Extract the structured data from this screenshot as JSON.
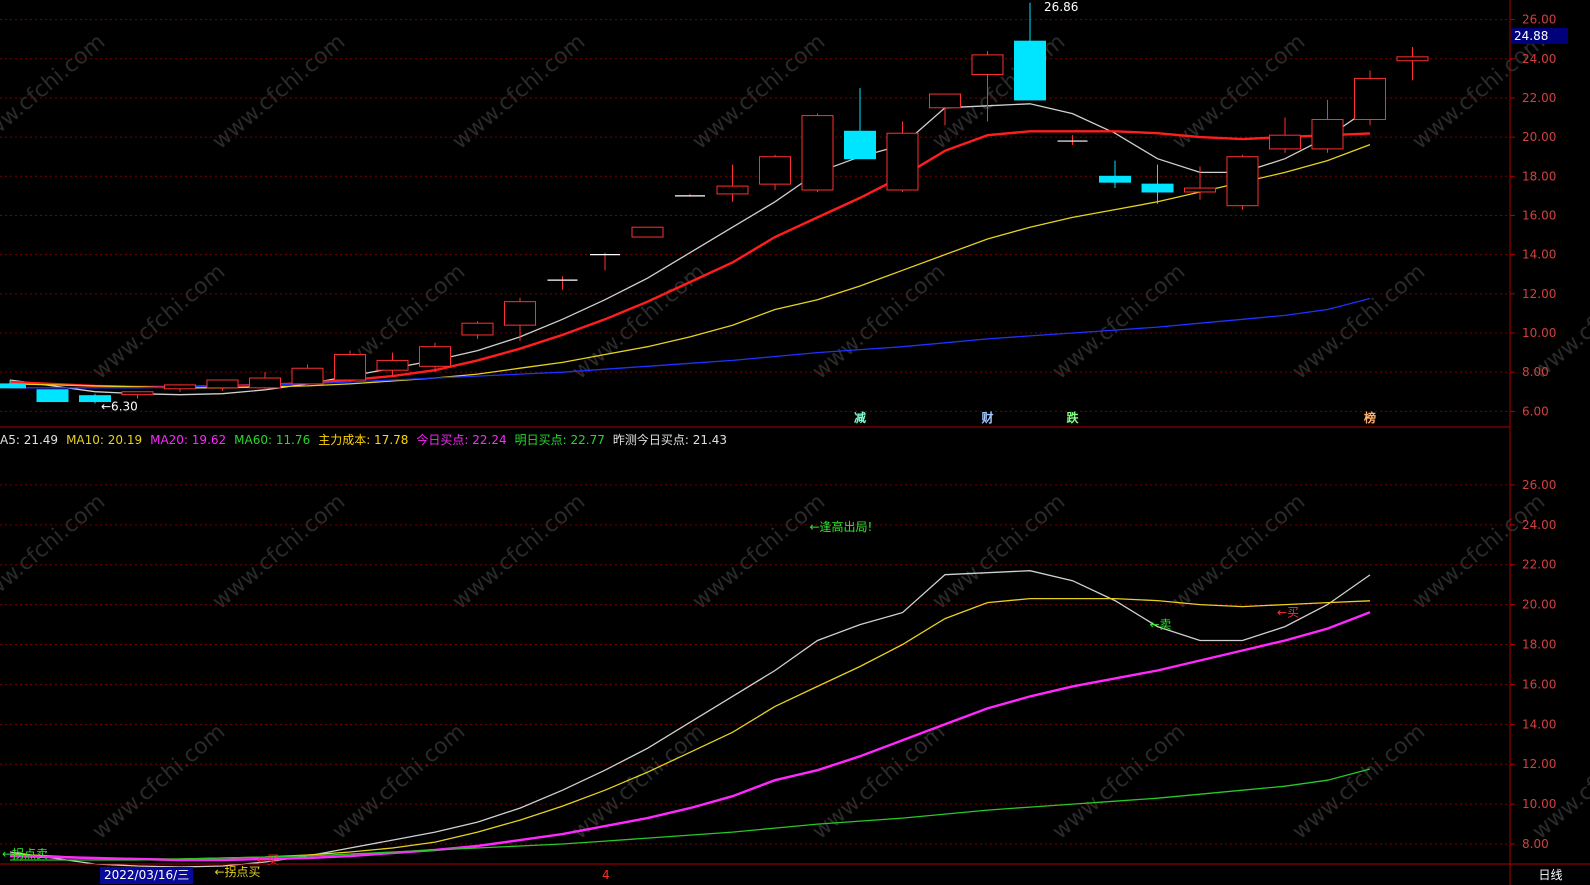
{
  "chart_data": [
    {
      "type": "candlestick",
      "panel": "main",
      "ylim": [
        5.2,
        26.9
      ],
      "y_ticks": [
        "26.00",
        "24.00",
        "22.00",
        "20.00",
        "18.00",
        "16.00",
        "14.00",
        "12.00",
        "10.00",
        "8.00",
        "6.00"
      ],
      "y_tick_values": [
        26,
        24,
        22,
        20,
        18,
        16,
        14,
        12,
        10,
        8,
        6
      ],
      "candles": [
        {
          "o": 7.4,
          "h": 7.6,
          "l": 7.2,
          "c": 7.2
        },
        {
          "o": 7.1,
          "h": 7.1,
          "l": 6.5,
          "c": 6.5
        },
        {
          "o": 6.8,
          "h": 6.9,
          "l": 6.4,
          "c": 6.5
        },
        {
          "o": 6.85,
          "h": 6.95,
          "l": 6.65,
          "c": 7.0
        },
        {
          "o": 7.15,
          "h": 7.3,
          "l": 7.0,
          "c": 7.35
        },
        {
          "o": 7.2,
          "h": 7.6,
          "l": 7.05,
          "c": 7.6
        },
        {
          "o": 7.2,
          "h": 8.0,
          "l": 7.1,
          "c": 7.7
        },
        {
          "o": 7.4,
          "h": 8.4,
          "l": 7.3,
          "c": 8.2
        },
        {
          "o": 7.6,
          "h": 9.1,
          "l": 7.5,
          "c": 8.9
        },
        {
          "o": 8.1,
          "h": 9.0,
          "l": 7.8,
          "c": 8.6
        },
        {
          "o": 8.3,
          "h": 9.5,
          "l": 8.0,
          "c": 9.3
        },
        {
          "o": 9.9,
          "h": 10.6,
          "l": 9.7,
          "c": 10.5
        },
        {
          "o": 10.4,
          "h": 11.8,
          "l": 9.6,
          "c": 11.6
        },
        {
          "o": 12.7,
          "h": 12.9,
          "l": 12.2,
          "c": 12.7
        },
        {
          "o": 14.0,
          "h": 14.1,
          "l": 13.2,
          "c": 14.0
        },
        {
          "o": 14.9,
          "h": 15.4,
          "l": 14.9,
          "c": 15.4
        },
        {
          "o": 17.0,
          "h": 17.1,
          "l": 17.0,
          "c": 17.0
        },
        {
          "o": 17.1,
          "h": 18.6,
          "l": 16.7,
          "c": 17.5
        },
        {
          "o": 17.6,
          "h": 19.1,
          "l": 17.3,
          "c": 19.0
        },
        {
          "o": 17.3,
          "h": 21.2,
          "l": 17.2,
          "c": 21.1
        },
        {
          "o": 20.3,
          "h": 22.5,
          "l": 18.9,
          "c": 18.9
        },
        {
          "o": 17.3,
          "h": 20.8,
          "l": 17.2,
          "c": 20.2
        },
        {
          "o": 21.5,
          "h": 22.2,
          "l": 20.6,
          "c": 22.2
        },
        {
          "o": 23.2,
          "h": 24.4,
          "l": 20.8,
          "c": 24.2
        },
        {
          "o": 24.9,
          "h": 26.86,
          "l": 21.9,
          "c": 21.9
        },
        {
          "o": 19.8,
          "h": 20.1,
          "l": 19.6,
          "c": 19.8
        },
        {
          "o": 18.0,
          "h": 18.8,
          "l": 17.4,
          "c": 17.7
        },
        {
          "o": 17.6,
          "h": 18.6,
          "l": 16.6,
          "c": 17.2
        },
        {
          "o": 17.2,
          "h": 18.5,
          "l": 16.8,
          "c": 17.4
        },
        {
          "o": 16.5,
          "h": 19.1,
          "l": 16.3,
          "c": 19.0
        },
        {
          "o": 19.4,
          "h": 21.0,
          "l": 19.2,
          "c": 20.1
        },
        {
          "o": 19.4,
          "h": 21.9,
          "l": 19.2,
          "c": 20.9
        },
        {
          "o": 20.9,
          "h": 23.4,
          "l": 20.6,
          "c": 23.0
        },
        {
          "o": 23.9,
          "h": 24.6,
          "l": 22.9,
          "c": 24.1
        }
      ],
      "series": [
        {
          "key": "white",
          "color": "#d0d0d0",
          "width": 1.3,
          "values": [
            7.6,
            7.3,
            7.0,
            6.9,
            6.85,
            6.9,
            7.1,
            7.4,
            7.8,
            8.2,
            8.6,
            9.1,
            9.8,
            10.7,
            11.7,
            12.8,
            14.1,
            15.4,
            16.7,
            18.2,
            19.0,
            19.6,
            21.5,
            21.6,
            21.7,
            21.2,
            20.2,
            18.9,
            18.2,
            18.2,
            18.9,
            20.0,
            21.49,
            null
          ]
        },
        {
          "key": "red",
          "color": "#ff1e1e",
          "width": 2.4,
          "values": [
            7.5,
            7.4,
            7.3,
            7.25,
            7.25,
            7.3,
            7.35,
            7.45,
            7.6,
            7.8,
            8.1,
            8.6,
            9.2,
            9.9,
            10.7,
            11.6,
            12.6,
            13.6,
            14.9,
            15.9,
            16.9,
            18.0,
            19.3,
            20.1,
            20.3,
            20.3,
            20.3,
            20.2,
            20.0,
            19.9,
            20.0,
            20.1,
            20.19,
            null
          ]
        },
        {
          "key": "yellow",
          "color": "#e6d21e",
          "width": 1.3,
          "values": [
            7.4,
            7.35,
            7.3,
            7.25,
            7.2,
            7.2,
            7.25,
            7.3,
            7.4,
            7.55,
            7.7,
            7.9,
            8.2,
            8.5,
            8.9,
            9.3,
            9.8,
            10.4,
            11.2,
            11.7,
            12.4,
            13.2,
            14.0,
            14.8,
            15.4,
            15.9,
            16.3,
            16.7,
            17.2,
            17.7,
            18.2,
            18.8,
            19.62,
            null
          ]
        },
        {
          "key": "blue",
          "color": "#1e32ff",
          "width": 1.3,
          "values": [
            7.2,
            7.2,
            7.2,
            7.2,
            7.25,
            7.3,
            7.35,
            7.4,
            7.5,
            7.6,
            7.7,
            7.8,
            7.9,
            8.0,
            8.15,
            8.3,
            8.45,
            8.6,
            8.8,
            9.0,
            9.15,
            9.3,
            9.5,
            9.7,
            9.85,
            10.0,
            10.15,
            10.3,
            10.5,
            10.7,
            10.9,
            11.2,
            11.76,
            null
          ]
        }
      ],
      "annotations": [
        {
          "text": "←6.30",
          "x_index": 2,
          "y": 6.3,
          "color": "#ffffff"
        },
        {
          "text": "26.86",
          "x_index": 24,
          "y": 26.86,
          "color": "#ffffff"
        }
      ],
      "markers": [
        {
          "text": "减",
          "x_index": 20,
          "color": "#7fffd4"
        },
        {
          "text": "财",
          "x_index": 23,
          "color": "#a0c8ff"
        },
        {
          "text": "跌",
          "x_index": 25,
          "color": "#7fff7f"
        },
        {
          "text": "榜",
          "x_index": 32,
          "color": "#ffb070"
        }
      ],
      "price_tag": "24.88"
    },
    {
      "type": "line",
      "panel": "indicator",
      "ylim": [
        7.0,
        27.8
      ],
      "y_ticks": [
        "26.00",
        "24.00",
        "22.00",
        "20.00",
        "18.00",
        "16.00",
        "14.00",
        "12.00",
        "10.00",
        "8.00"
      ],
      "y_tick_values": [
        26,
        24,
        22,
        20,
        18,
        16,
        14,
        12,
        10,
        8
      ],
      "series": [
        {
          "key": "white",
          "color": "#d0d0d0",
          "width": 1.3,
          "values": [
            7.6,
            7.3,
            7.0,
            6.9,
            6.85,
            6.9,
            7.1,
            7.4,
            7.8,
            8.2,
            8.6,
            9.1,
            9.8,
            10.7,
            11.7,
            12.8,
            14.1,
            15.4,
            16.7,
            18.2,
            19.0,
            19.6,
            21.5,
            21.6,
            21.7,
            21.2,
            20.2,
            18.9,
            18.2,
            18.2,
            18.9,
            20.0,
            21.49,
            null
          ]
        },
        {
          "key": "yellow",
          "color": "#e6d21e",
          "width": 1.3,
          "values": [
            7.5,
            7.4,
            7.3,
            7.25,
            7.25,
            7.3,
            7.35,
            7.45,
            7.6,
            7.8,
            8.1,
            8.6,
            9.2,
            9.9,
            10.7,
            11.6,
            12.6,
            13.6,
            14.9,
            15.9,
            16.9,
            18.0,
            19.3,
            20.1,
            20.3,
            20.3,
            20.3,
            20.2,
            20.0,
            19.9,
            20.0,
            20.1,
            20.19,
            null
          ]
        },
        {
          "key": "magenta",
          "color": "#ff28ff",
          "width": 2.4,
          "values": [
            7.4,
            7.35,
            7.3,
            7.25,
            7.2,
            7.2,
            7.25,
            7.3,
            7.4,
            7.55,
            7.7,
            7.9,
            8.2,
            8.5,
            8.9,
            9.3,
            9.8,
            10.4,
            11.2,
            11.7,
            12.4,
            13.2,
            14.0,
            14.8,
            15.4,
            15.9,
            16.3,
            16.7,
            17.2,
            17.7,
            18.2,
            18.8,
            19.62,
            null
          ]
        },
        {
          "key": "green",
          "color": "#28c828",
          "width": 1.3,
          "values": [
            7.2,
            7.2,
            7.2,
            7.2,
            7.25,
            7.3,
            7.35,
            7.4,
            7.5,
            7.6,
            7.7,
            7.8,
            7.9,
            8.0,
            8.15,
            8.3,
            8.45,
            8.6,
            8.8,
            9.0,
            9.15,
            9.3,
            9.5,
            9.7,
            9.85,
            10.0,
            10.15,
            10.3,
            10.5,
            10.7,
            10.9,
            11.2,
            11.76,
            null
          ]
        }
      ],
      "signals": [
        {
          "text": "←逢高出局!",
          "x_index": 19,
          "y": 23.9,
          "color": "#2ee82e"
        },
        {
          "text": "←卖",
          "x_index": 27,
          "y": 19.0,
          "color": "#2ee82e"
        },
        {
          "text": "←买",
          "x_index": 30,
          "y": 19.6,
          "color": "#ff3030"
        },
        {
          "text": "←拐点卖",
          "x_index": 0,
          "y": 7.5,
          "color": "#2ee82e"
        },
        {
          "text": "←拐点买",
          "x_index": 5,
          "y": 6.6,
          "color": "#e6d21e"
        },
        {
          "text": "←买",
          "x_index": 6,
          "y": 7.2,
          "color": "#ff3030"
        }
      ]
    }
  ],
  "indicator_bar": [
    {
      "text": "A5: 21.49",
      "color": "#e0e0e0"
    },
    {
      "text": "MA10: 20.19",
      "color": "#e6d21e"
    },
    {
      "text": "MA20: 19.62",
      "color": "#ff28ff"
    },
    {
      "text": "MA60: 11.76",
      "color": "#28d828"
    },
    {
      "text": "主力成本: 17.78",
      "color": "#ffd700"
    },
    {
      "text": "今日买点: 22.24",
      "color": "#ff28ff"
    },
    {
      "text": "明日买点: 22.77",
      "color": "#28d828"
    },
    {
      "text": "昨测今日买点: 21.43",
      "color": "#e0e0e0"
    }
  ],
  "bottom_bar": {
    "date_label": "2022/03/16/三",
    "month_marker": "4",
    "period_label": "日线"
  },
  "watermark": "www.cfchi.com",
  "colors": {
    "grid": "#7a0000",
    "axis": "#b00000",
    "up": "#ff3030",
    "down": "#00e5ff",
    "tick": "#d04040"
  }
}
